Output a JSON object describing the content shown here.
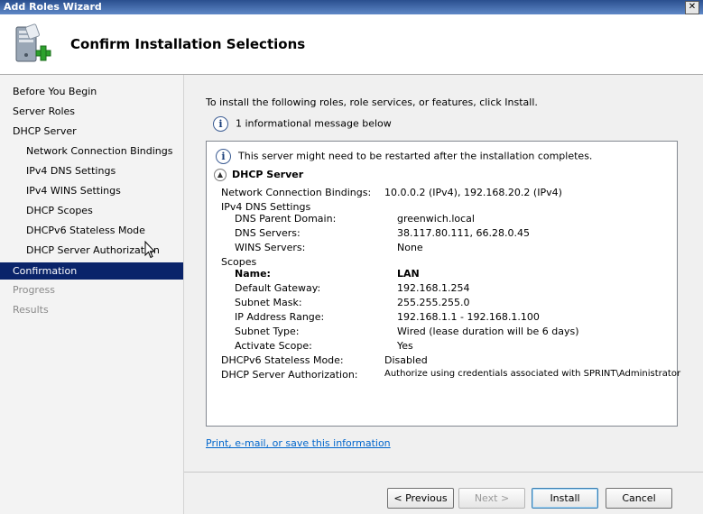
{
  "window": {
    "title": "Add Roles Wizard",
    "close_glyph": "✕"
  },
  "header": {
    "title": "Confirm Installation Selections",
    "icon": "server-roles-add-icon"
  },
  "sidebar": {
    "items": [
      {
        "label": "Before You Begin",
        "state": "normal",
        "level": 0
      },
      {
        "label": "Server Roles",
        "state": "normal",
        "level": 0
      },
      {
        "label": "DHCP Server",
        "state": "normal",
        "level": 0
      },
      {
        "label": "Network Connection Bindings",
        "state": "normal",
        "level": 1
      },
      {
        "label": "IPv4 DNS Settings",
        "state": "normal",
        "level": 1
      },
      {
        "label": "IPv4 WINS Settings",
        "state": "normal",
        "level": 1
      },
      {
        "label": "DHCP Scopes",
        "state": "normal",
        "level": 1
      },
      {
        "label": "DHCPv6 Stateless Mode",
        "state": "normal",
        "level": 1
      },
      {
        "label": "DHCP Server Authorization",
        "state": "normal",
        "level": 1
      },
      {
        "label": "Confirmation",
        "state": "active",
        "level": 0
      },
      {
        "label": "Progress",
        "state": "disabled",
        "level": 0
      },
      {
        "label": "Results",
        "state": "disabled",
        "level": 0
      }
    ]
  },
  "main": {
    "intro": "To install the following roles, role services, or features, click Install.",
    "info_count": "1 informational message below",
    "panel": {
      "message": "This server might need to be restarted after the installation completes.",
      "section_title": "DHCP Server",
      "rows": {
        "ncb_label": "Network Connection Bindings:",
        "ncb_value": "10.0.0.2 (IPv4), 192.168.20.2 (IPv4)",
        "ipv4dns_label": "IPv4 DNS Settings",
        "dns_parent_label": "DNS Parent Domain:",
        "dns_parent_value": "greenwich.local",
        "dns_servers_label": "DNS Servers:",
        "dns_servers_value": "38.117.80.111, 66.28.0.45",
        "wins_label": "WINS Servers:",
        "wins_value": "None",
        "scopes_label": "Scopes",
        "name_label": "Name:",
        "name_value": "LAN",
        "gateway_label": "Default Gateway:",
        "gateway_value": "192.168.1.254",
        "subnet_label": "Subnet Mask:",
        "subnet_value": "255.255.255.0",
        "range_label": "IP Address Range:",
        "range_value": "192.168.1.1 - 192.168.1.100",
        "subnet_type_label": "Subnet Type:",
        "subnet_type_value": "Wired (lease duration will be 6 days)",
        "activate_label": "Activate Scope:",
        "activate_value": "Yes",
        "v6_label": "DHCPv6 Stateless Mode:",
        "v6_value": "Disabled",
        "auth_label": "DHCP Server Authorization:",
        "auth_value": "Authorize using credentials associated with SPRINT\\Administrator"
      }
    },
    "link": "Print, e-mail, or save this information"
  },
  "buttons": {
    "previous": "< Previous",
    "next": "Next >",
    "install": "Install",
    "cancel": "Cancel"
  },
  "colors": {
    "active_nav": "#0a246a",
    "link": "#0066cc"
  }
}
